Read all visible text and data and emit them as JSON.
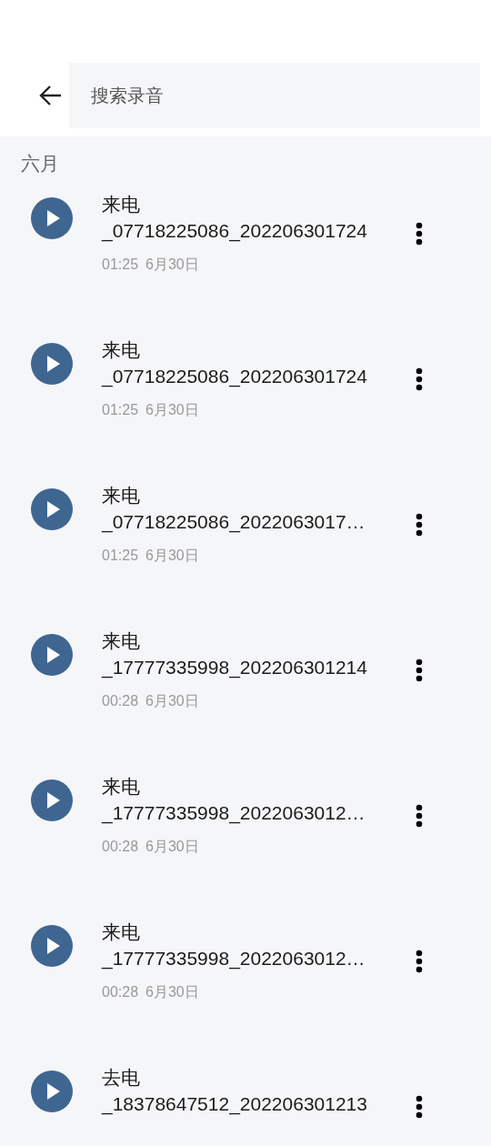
{
  "search": {
    "placeholder": "搜索录音"
  },
  "section": "六月",
  "recordings": [
    {
      "call_type": "来电",
      "name": "_07718225086_202206301724",
      "duration": "01:25",
      "date": "6月30日"
    },
    {
      "call_type": "来电",
      "name": "_07718225086_202206301724",
      "duration": "01:25",
      "date": "6月30日"
    },
    {
      "call_type": "来电",
      "name": "_07718225086_2022063017…",
      "duration": "01:25",
      "date": "6月30日"
    },
    {
      "call_type": "来电",
      "name": "_17777335998_202206301214",
      "duration": "00:28",
      "date": "6月30日"
    },
    {
      "call_type": "来电",
      "name": "_17777335998_2022063012…",
      "duration": "00:28",
      "date": "6月30日"
    },
    {
      "call_type": "来电",
      "name": "_17777335998_2022063012…",
      "duration": "00:28",
      "date": "6月30日"
    },
    {
      "call_type": "去电",
      "name": "_18378647512_202206301213"
    }
  ]
}
